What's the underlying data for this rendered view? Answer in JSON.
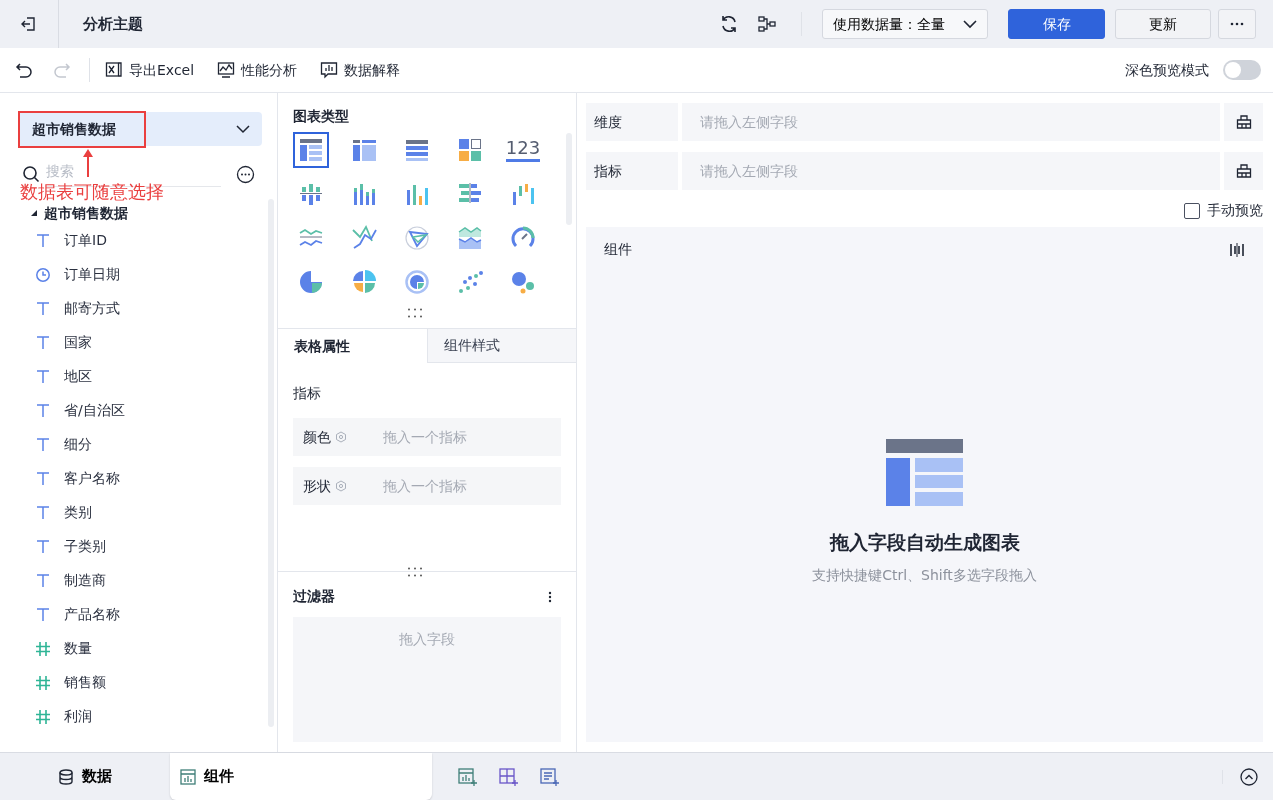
{
  "header": {
    "title": "分析主题",
    "data_amount": "使用数据量：全量",
    "save": "保存",
    "update": "更新"
  },
  "toolbar": {
    "redo_disabled": true,
    "actions": [
      {
        "kind": "excel",
        "label": "导出Excel"
      },
      {
        "kind": "performance",
        "label": "性能分析"
      },
      {
        "kind": "explain",
        "label": "数据解释"
      }
    ],
    "dark_preview": {
      "label": "深色预览模式",
      "on": false
    }
  },
  "data_panel": {
    "dataset": "超市销售数据",
    "annotation": "数据表可随意选择",
    "search_placeholder": "搜索",
    "tree": {
      "label": "超市销售数据",
      "expanded": true,
      "children": [
        {
          "kind": "text",
          "label": "订单ID"
        },
        {
          "kind": "date",
          "label": "订单日期"
        },
        {
          "kind": "text",
          "label": "邮寄方式"
        },
        {
          "kind": "text",
          "label": "国家"
        },
        {
          "kind": "text",
          "label": "地区"
        },
        {
          "kind": "text",
          "label": "省/自治区"
        },
        {
          "kind": "text",
          "label": "细分"
        },
        {
          "kind": "text",
          "label": "客户名称"
        },
        {
          "kind": "text",
          "label": "类别"
        },
        {
          "kind": "text",
          "label": "子类别"
        },
        {
          "kind": "text",
          "label": "制造商"
        },
        {
          "kind": "text",
          "label": "产品名称"
        },
        {
          "kind": "number",
          "label": "数量"
        },
        {
          "kind": "number",
          "label": "销售额"
        },
        {
          "kind": "number",
          "label": "利润"
        }
      ]
    }
  },
  "chart_panel": {
    "title": "图表类型",
    "chart_types": [
      {
        "kind": "group-table",
        "selected": true
      },
      {
        "kind": "cross-table",
        "selected": false
      },
      {
        "kind": "detail-table",
        "selected": false
      },
      {
        "kind": "kpi-card",
        "selected": false
      },
      {
        "kind": "number",
        "label": "123",
        "selected": false
      },
      {
        "kind": "grouped-bar",
        "selected": false
      },
      {
        "kind": "stacked-bar",
        "selected": false
      },
      {
        "kind": "bar",
        "selected": false
      },
      {
        "kind": "horizontal-bar",
        "selected": false
      },
      {
        "kind": "range-bar",
        "selected": false
      },
      {
        "kind": "line",
        "selected": false
      },
      {
        "kind": "cross-line",
        "selected": false
      },
      {
        "kind": "radar",
        "selected": false
      },
      {
        "kind": "area",
        "selected": false
      },
      {
        "kind": "gauge",
        "selected": false
      },
      {
        "kind": "pie",
        "selected": false
      },
      {
        "kind": "rose",
        "selected": false
      },
      {
        "kind": "donut",
        "selected": false
      },
      {
        "kind": "scatter",
        "selected": false
      },
      {
        "kind": "bubble",
        "selected": false
      }
    ],
    "tabs": [
      {
        "label": "表格属性",
        "selected": true
      },
      {
        "label": "组件样式",
        "selected": false
      }
    ],
    "section": "指标",
    "props": [
      {
        "label": "颜色",
        "placeholder": "拖入一个指标"
      },
      {
        "label": "形状",
        "placeholder": "拖入一个指标"
      }
    ],
    "filter": {
      "title": "过滤器",
      "placeholder": "拖入字段"
    }
  },
  "design": {
    "shelves": [
      {
        "label": "维度",
        "placeholder": "请拖入左侧字段"
      },
      {
        "label": "指标",
        "placeholder": "请拖入左侧字段"
      }
    ],
    "manual_preview": {
      "label": "手动预览",
      "checked": false
    },
    "component": {
      "title": "组件",
      "empty_title": "拖入字段自动生成图表",
      "empty_hint": "支持快捷键Ctrl、Shift多选字段拖入"
    }
  },
  "bottom_tabs": [
    {
      "kind": "data",
      "label": "数据",
      "selected": false
    },
    {
      "kind": "component",
      "label": "组件",
      "selected": true
    }
  ]
}
